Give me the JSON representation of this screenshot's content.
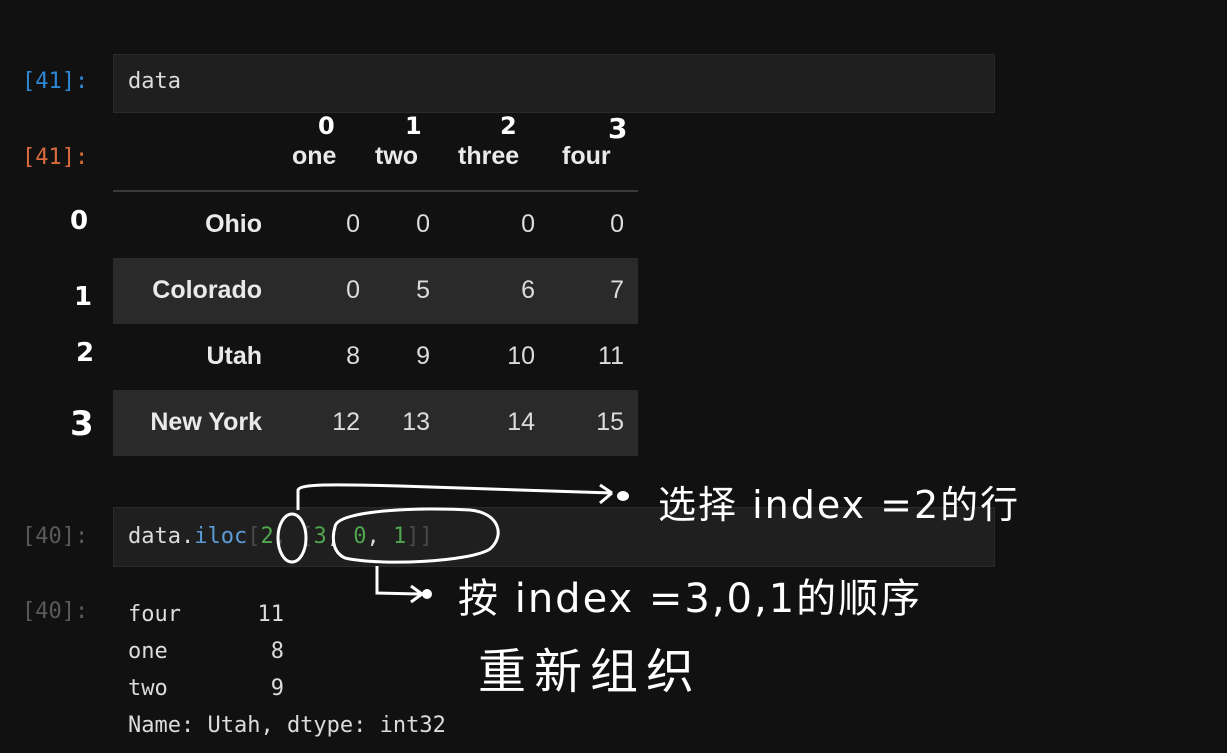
{
  "cell41": {
    "in_prompt": "[41]:",
    "out_prompt": "[41]:",
    "code": "data"
  },
  "dataframe": {
    "columns": [
      "one",
      "two",
      "three",
      "four"
    ],
    "rows": [
      {
        "index": "Ohio",
        "values": [
          "0",
          "0",
          "0",
          "0"
        ]
      },
      {
        "index": "Colorado",
        "values": [
          "0",
          "5",
          "6",
          "7"
        ]
      },
      {
        "index": "Utah",
        "values": [
          "8",
          "9",
          "10",
          "11"
        ]
      },
      {
        "index": "New York",
        "values": [
          "12",
          "13",
          "14",
          "15"
        ]
      }
    ]
  },
  "cell40": {
    "in_prompt": "[40]:",
    "out_prompt": "[40]:",
    "code_obj": "data.",
    "code_attr": "iloc",
    "code_open": "[",
    "code_row": "2",
    "code_comma": ", ",
    "code_list_open": "[",
    "code_n1": "3",
    "code_sep1": ", ",
    "code_n2": "0",
    "code_sep2": ", ",
    "code_n3": "1",
    "code_close": "]]"
  },
  "series_output": {
    "items": [
      {
        "key": "four",
        "value": "11"
      },
      {
        "key": "one",
        "value": "8"
      },
      {
        "key": "two",
        "value": "9"
      }
    ],
    "footer": "Name: Utah, dtype: int32"
  },
  "annotations": {
    "col_numbers": [
      "0",
      "1",
      "2",
      "3"
    ],
    "row_numbers": [
      "0",
      "1",
      "2",
      "3"
    ],
    "note_row": "选择 index =2的行",
    "note_order_line1": "按 index =3,0,1的顺序",
    "note_order_line2": "重新组织"
  }
}
